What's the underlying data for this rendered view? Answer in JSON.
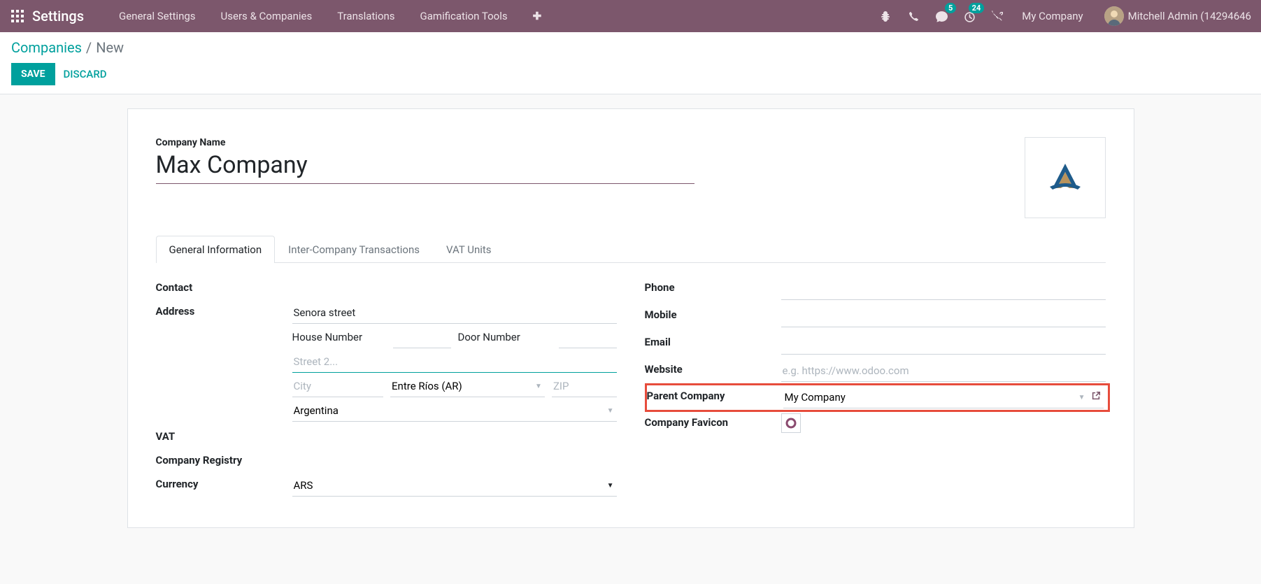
{
  "brand": "Settings",
  "nav": {
    "menus": [
      "General Settings",
      "Users & Companies",
      "Translations",
      "Gamification Tools"
    ],
    "msg_badge": "5",
    "timer_badge": "24",
    "company": "My Company",
    "user": "Mitchell Admin (14294646"
  },
  "breadcrumb": {
    "root": "Companies",
    "current": "New"
  },
  "buttons": {
    "save": "SAVE",
    "discard": "DISCARD"
  },
  "form": {
    "company_name_label": "Company Name",
    "company_name": "Max Company",
    "tabs": [
      "General Information",
      "Inter-Company Transactions",
      "VAT Units"
    ],
    "left": {
      "contact": "Contact",
      "address": "Address",
      "street": "Senora street",
      "house_lbl": "House Number",
      "door_lbl": "Door Number",
      "street2_ph": "Street 2...",
      "city_ph": "City",
      "state": "Entre Ríos (AR)",
      "zip_ph": "ZIP",
      "country": "Argentina",
      "vat": "VAT",
      "registry": "Company Registry",
      "currency": "Currency",
      "currency_val": "ARS"
    },
    "right": {
      "phone": "Phone",
      "mobile": "Mobile",
      "email": "Email",
      "website": "Website",
      "website_ph": "e.g. https://www.odoo.com",
      "parent": "Parent Company",
      "parent_val": "My Company",
      "favicon": "Company Favicon"
    }
  }
}
